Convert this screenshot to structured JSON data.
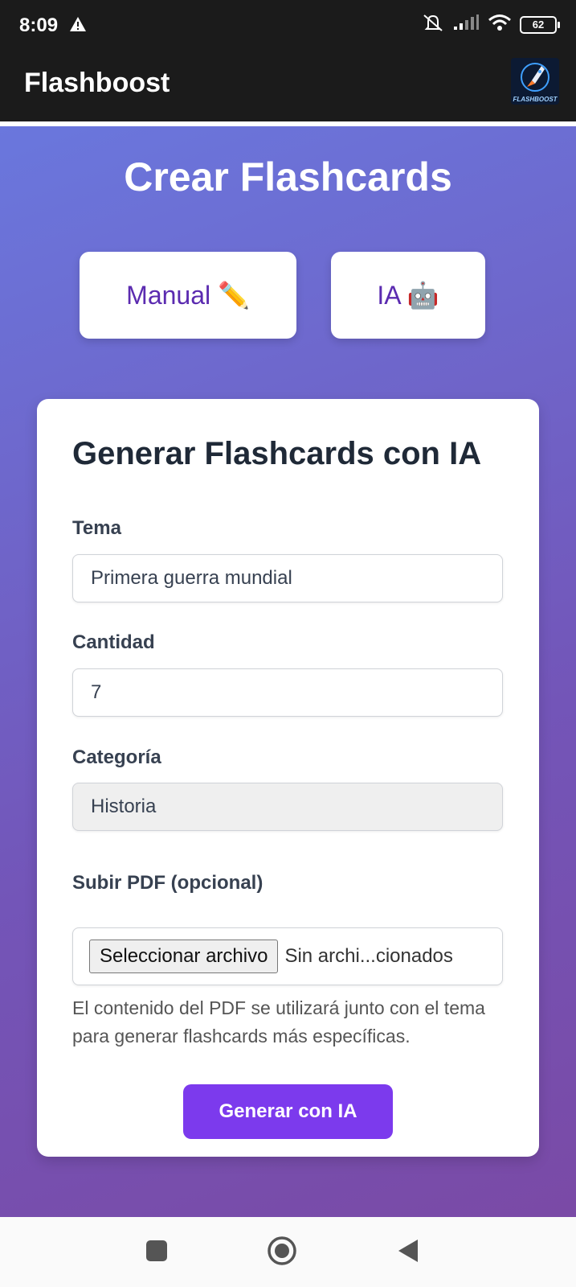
{
  "status": {
    "time": "8:09",
    "battery": "62"
  },
  "app": {
    "title": "Flashboost",
    "logo_text": "FLASHBOOST"
  },
  "page": {
    "title": "Crear Flashcards",
    "tabs": [
      {
        "label": "Manual ✏️"
      },
      {
        "label": "IA 🤖"
      }
    ]
  },
  "form": {
    "heading": "Generar Flashcards con IA",
    "tema": {
      "label": "Tema",
      "value": "Primera guerra mundial"
    },
    "cantidad": {
      "label": "Cantidad",
      "value": "7"
    },
    "categoria": {
      "label": "Categoría",
      "value": "Historia"
    },
    "pdf": {
      "label": "Subir PDF (opcional)",
      "button": "Seleccionar archivo",
      "file_status": "Sin archi...cionados",
      "help": "El contenido del PDF se utilizará junto con el tema para generar flashcards más específicas."
    },
    "submit": "Generar con IA"
  },
  "colors": {
    "accent": "#7c3aed",
    "tab_text": "#5b2bb0",
    "gradient_start": "#6a77dd",
    "gradient_end": "#7a4aa6"
  },
  "icons": [
    "warning-icon",
    "mute-icon",
    "signal-icon",
    "wifi-icon",
    "battery-icon",
    "app-logo",
    "nav-recents-icon",
    "nav-home-icon",
    "nav-back-icon"
  ]
}
